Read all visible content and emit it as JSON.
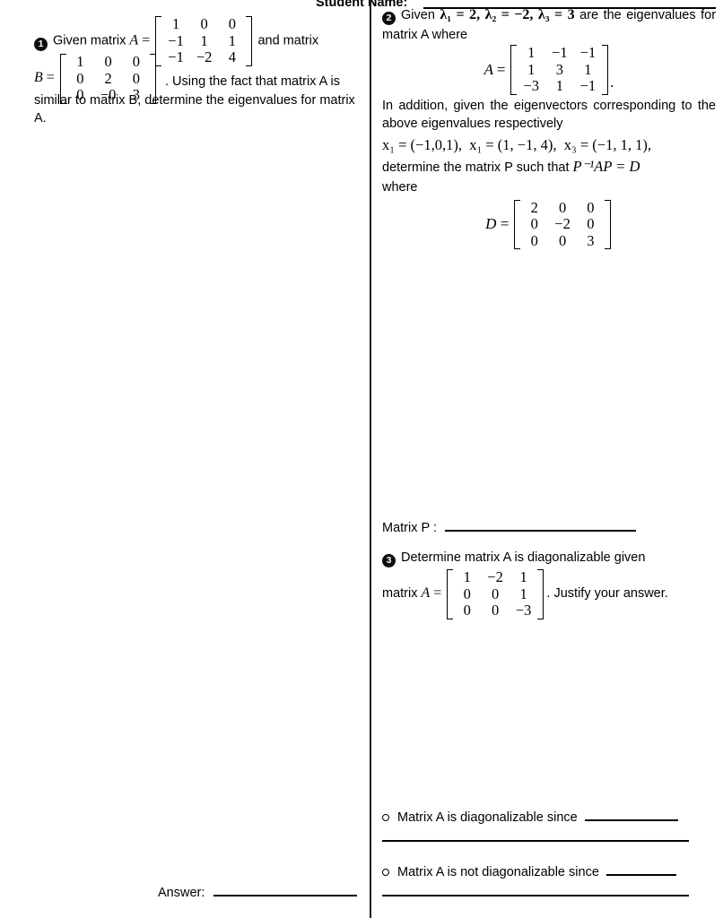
{
  "document": {
    "type": "exam-worksheet",
    "header": {
      "student_name_label": "Student Name:"
    }
  },
  "left_column": {
    "question1": {
      "number": "1",
      "text_part1": "Given matrix",
      "var_A": "A",
      "equals": "=",
      "matrix_A": [
        [
          "1",
          "0",
          "0"
        ],
        [
          "−1",
          "1",
          "1"
        ],
        [
          "−1",
          "−2",
          "4"
        ]
      ],
      "text_part2": "and matrix",
      "var_B": "B",
      "matrix_B": [
        [
          "1",
          "0",
          "0"
        ],
        [
          "0",
          "2",
          "0"
        ],
        [
          "0",
          "−0",
          "3"
        ]
      ],
      "text_part3": ". Using the fact that matrix A is similar to matrix B, determine the eigenvalues for matrix A."
    },
    "answer": {
      "label": "Answer:"
    }
  },
  "right_column": {
    "question2": {
      "number": "2",
      "text_intro": "Given",
      "eigenvalue1": "λ₁ = 2,",
      "eigenvalue2": "λ₂ = −2,",
      "eigenvalue3": "λ₃ = 3",
      "text_after_eigenvalues": "are the eigenvalues for matrix A where",
      "var_A": "A",
      "equals": "=",
      "matrix_A": [
        [
          "1",
          "−1",
          "−1"
        ],
        [
          "1",
          "3",
          "1"
        ],
        [
          "−3",
          "1",
          "−1"
        ]
      ],
      "matrix_A_trailing": ".",
      "text_eigenvectors_intro": "In addition, given the eigenvectors corresponding to the above eigenvalues respectively",
      "eigenvector1": "x₁ = (−1,0,1),",
      "eigenvector2": "x₁ = (1, −1, 4),",
      "eigenvector3": "x₃ = (−1, 1, 1),",
      "text_determine": "determine the matrix P such that",
      "equation_PAP": "P⁻¹AP = D",
      "text_where": "where",
      "var_D": "D",
      "matrix_D": [
        [
          "2",
          "0",
          "0"
        ],
        [
          "0",
          "−2",
          "0"
        ],
        [
          "0",
          "0",
          "3"
        ]
      ],
      "matrix_p_label": "Matrix P :"
    },
    "question3": {
      "number": "3",
      "text_part1": "Determine matrix A is diagonalizable given",
      "text_matrix_lead": "matrix",
      "var_A": "A",
      "equals": "=",
      "matrix_A": [
        [
          "1",
          "−2",
          "1"
        ],
        [
          "0",
          "0",
          "1"
        ],
        [
          "0",
          "0",
          "−3"
        ]
      ],
      "text_part2": ". Justify your answer.",
      "options": [
        {
          "text": "Matrix A is diagonalizable since"
        },
        {
          "text": "Matrix A is not diagonalizable since"
        }
      ]
    }
  },
  "colors": {
    "text": "#000000",
    "background": "#ffffff",
    "badge_background": "#0d0d0d",
    "badge_text": "#ffffff",
    "divider": "#1a1a1a"
  }
}
